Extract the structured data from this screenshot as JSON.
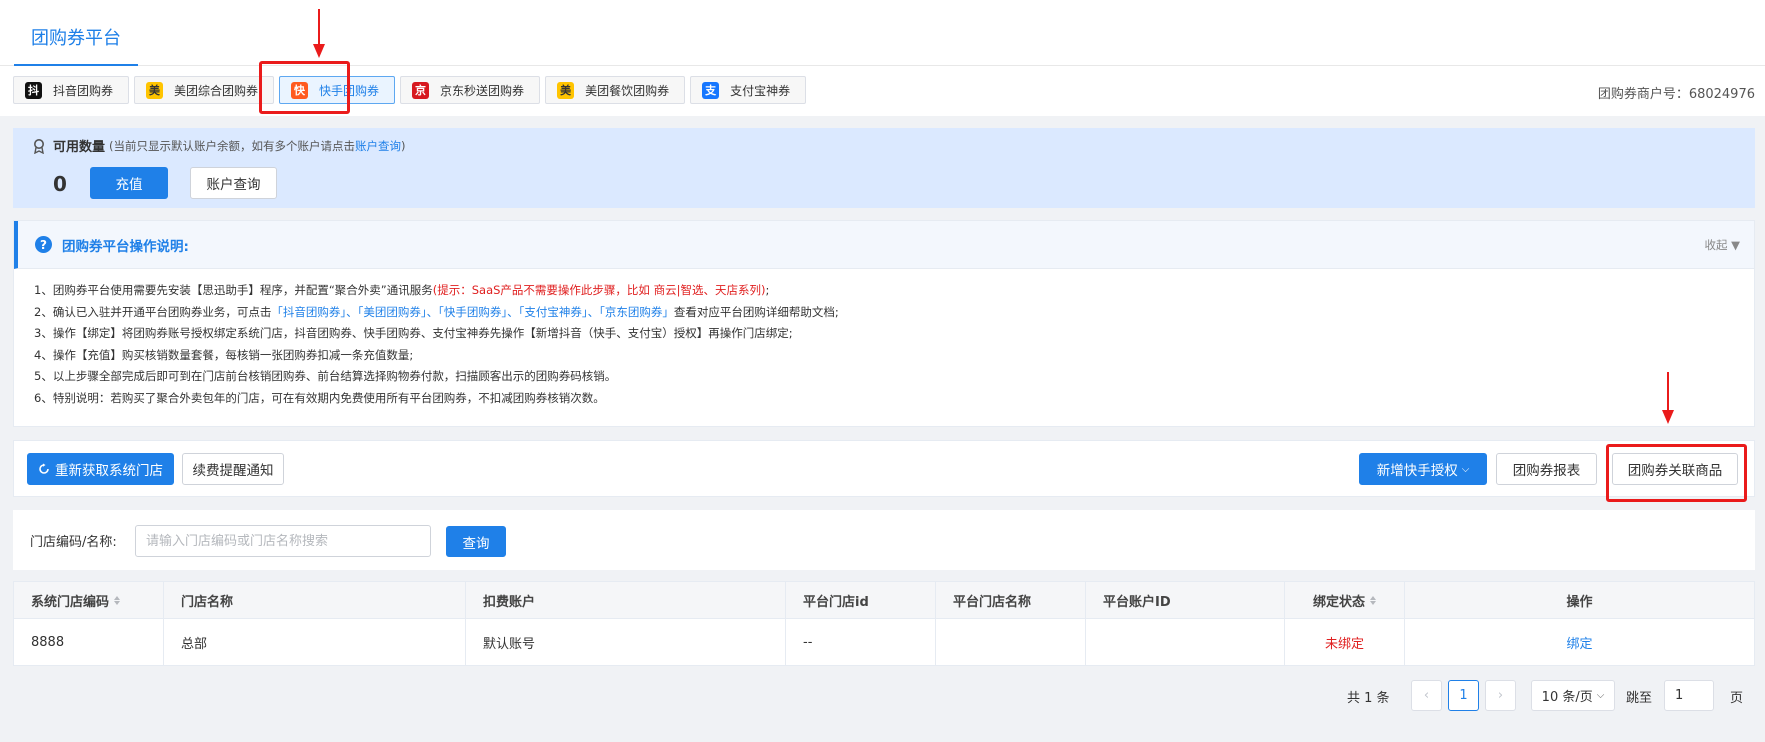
{
  "header": {
    "title": "团购券平台"
  },
  "platform_tabs": [
    {
      "badge": "抖",
      "label": "抖音团购券",
      "color": "#111111"
    },
    {
      "badge": "美",
      "label": "美团综合团购券",
      "color": "#ffc400"
    },
    {
      "badge": "快",
      "label": "快手团购券",
      "color": "#ff5a1f"
    },
    {
      "badge": "京",
      "label": "京东秒送团购券",
      "color": "#d71920"
    },
    {
      "badge": "美",
      "label": "美团餐饮团购券",
      "color": "#ffc400"
    },
    {
      "badge": "支",
      "label": "支付宝神券",
      "color": "#1677ff"
    }
  ],
  "merchant": {
    "text": "团购券商户号：68024976"
  },
  "quota": {
    "label": "可用数量",
    "hint_prefix": "(当前只显示默认账户余额，如有多个账户请点击",
    "hint_link": "账户查询",
    "hint_suffix": ")",
    "count": "0",
    "recharge_label": "充值",
    "account_query_label": "账户查询"
  },
  "guide": {
    "title": "团购券平台操作说明:",
    "collapse_label": "收起 ▼",
    "line1": {
      "text": "1、团购券平台使用需要先安装【思迅助手】程序，并配置“聚合外卖”通讯服务",
      "tip": "(提示：SaaS产品不需要操作此步骤，比如 商云|智选、天店系列)",
      "end": ";"
    },
    "line2": {
      "prefix": "2、确认已入驻并开通平台团购券业务，可点击",
      "links": "「抖音团购券」、「美团团购券」、「快手团购券」、「支付宝神券」、「京东团购券」",
      "suffix": "查看对应平台团购详细帮助文档;"
    },
    "line3": "3、操作【绑定】将团购券账号授权绑定系统门店，抖音团购券、快手团购券、支付宝神券先操作【新增抖音（快手、支付宝）授权】再操作门店绑定;",
    "line4": "4、操作【充值】购买核销数量套餐，每核销一张团购券扣减一条充值数量;",
    "line5": "5、以上步骤全部完成后即可到在门店前台核销团购券、前台结算选择购物券付款，扫描顾客出示的团购券码核销。",
    "line6": "6、特别说明：若购买了聚合外卖包年的门店，可在有效期内免费使用所有平台团购券，不扣减团购券核销次数。"
  },
  "actions": {
    "refresh_label": "重新获取系统门店",
    "renew_label": "续费提醒通知",
    "add_auth_label": "新增快手授权",
    "report_label": "团购券报表",
    "link_goods_label": "团购券关联商品"
  },
  "search": {
    "label": "门店编码/名称:",
    "placeholder": "请输入门店编码或门店名称搜索",
    "button": "查询"
  },
  "table": {
    "columns": [
      "系统门店编码",
      "门店名称",
      "扣费账户",
      "平台门店id",
      "平台门店名称",
      "平台账户ID",
      "绑定状态",
      "操作"
    ],
    "rows": [
      {
        "code": "8888",
        "name": "总部",
        "account": "默认账号",
        "platform_id": "--",
        "platform_name": "",
        "platform_account": "",
        "status": "未绑定",
        "action": "绑定"
      }
    ]
  },
  "pagination": {
    "total": "共 1 条",
    "current_page": "1",
    "page_size": "10 条/页",
    "jump_label": "跳至",
    "jump_value": "1",
    "page_unit": "页"
  },
  "colors": {
    "primary": "#1f80e8",
    "highlight": "#ea1b1b",
    "unbound": "#e02020"
  }
}
